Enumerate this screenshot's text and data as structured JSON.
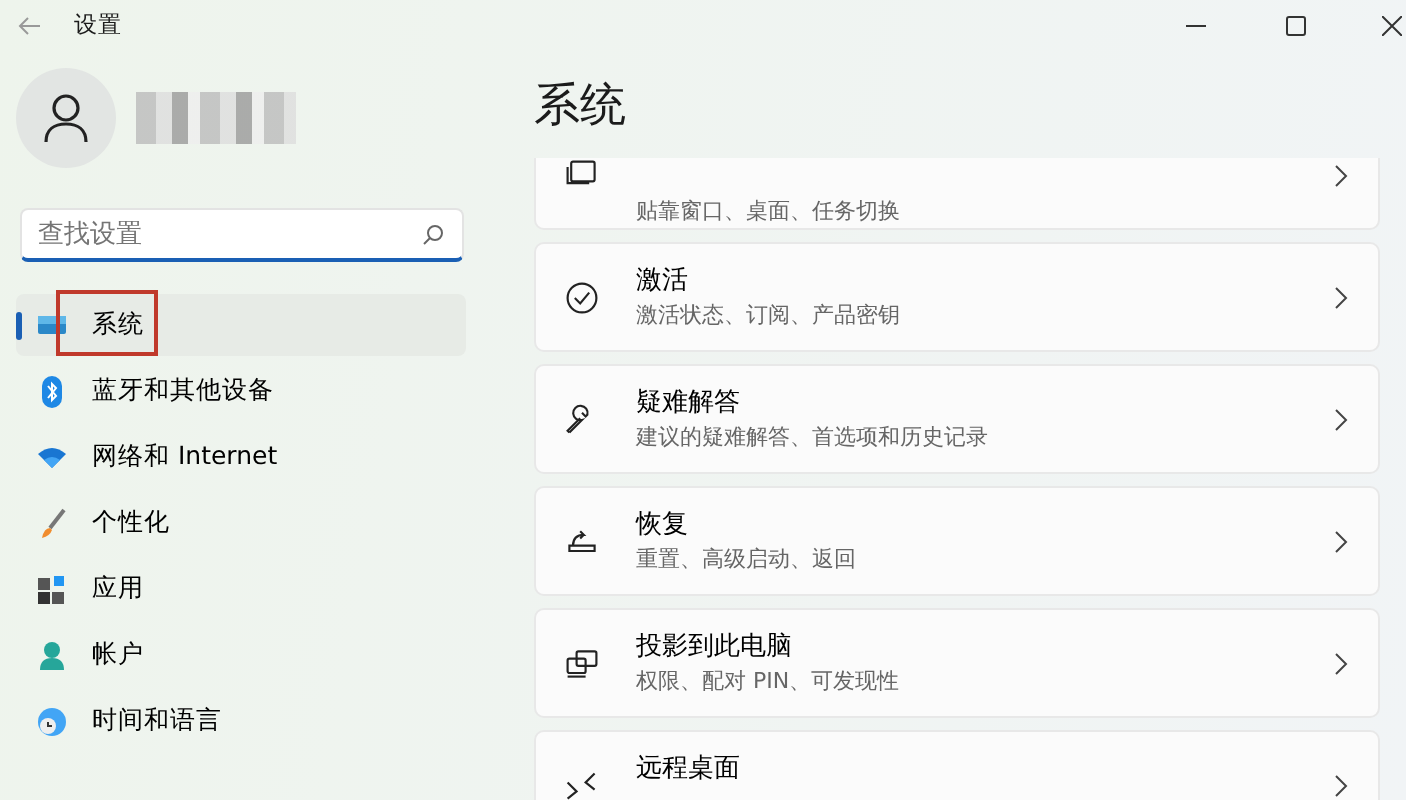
{
  "window": {
    "title": "设置"
  },
  "search": {
    "placeholder": "查找设置"
  },
  "nav": [
    {
      "label": "系统",
      "selected": true,
      "highlighted": true
    },
    {
      "label": "蓝牙和其他设备",
      "selected": false,
      "highlighted": false
    },
    {
      "label": "网络和 Internet",
      "selected": false,
      "highlighted": false
    },
    {
      "label": "个性化",
      "selected": false,
      "highlighted": false
    },
    {
      "label": "应用",
      "selected": false,
      "highlighted": false
    },
    {
      "label": "帐户",
      "selected": false,
      "highlighted": false
    },
    {
      "label": "时间和语言",
      "selected": false,
      "highlighted": false
    }
  ],
  "page_title": "系统",
  "settings": [
    {
      "subtitle": "贴靠窗口、桌面、任务切换"
    },
    {
      "title": "激活",
      "subtitle": "激活状态、订阅、产品密钥"
    },
    {
      "title": "疑难解答",
      "subtitle": "建议的疑难解答、首选项和历史记录"
    },
    {
      "title": "恢复",
      "subtitle": "重置、高级启动、返回"
    },
    {
      "title": "投影到此电脑",
      "subtitle": "权限、配对 PIN、可发现性"
    },
    {
      "title": "远程桌面"
    }
  ]
}
